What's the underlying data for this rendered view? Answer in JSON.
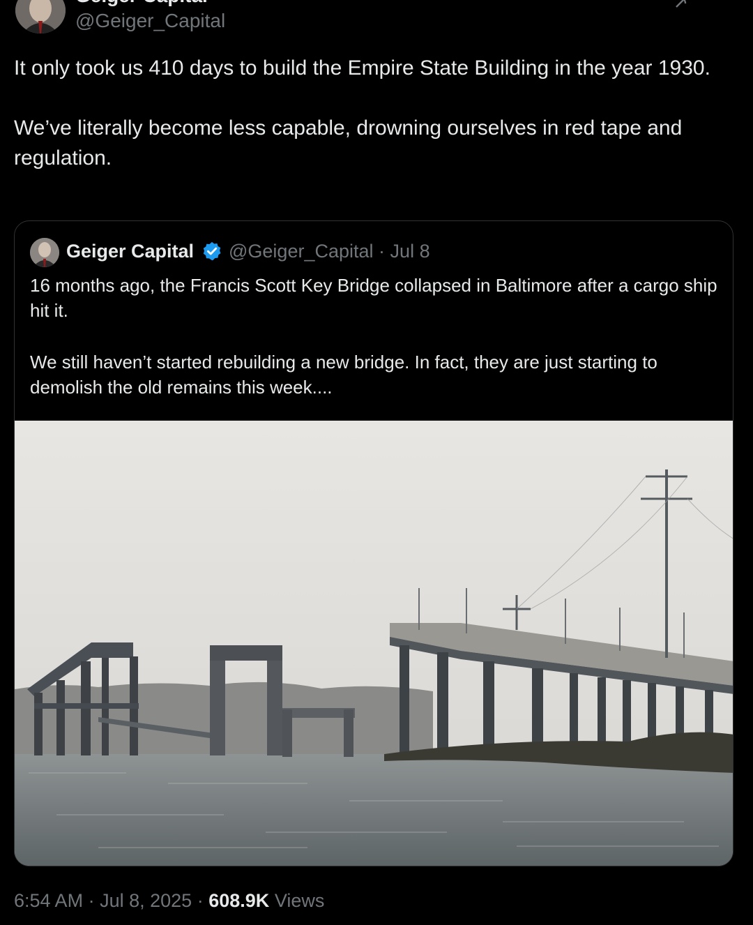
{
  "author": {
    "display_name": "Geiger Capital",
    "handle": "@Geiger_Capital",
    "verified_badge_icon": "verified-badge-icon",
    "avatar_icon": "avatar"
  },
  "tweet": {
    "paragraphs": [
      "It only took us 410 days to build the Empire State Building in the year 1930.",
      "We’ve literally become less capable, drowning ourselves in red tape and regulation."
    ]
  },
  "quoted_tweet": {
    "display_name": "Geiger Capital",
    "handle": "@Geiger_Capital",
    "separator": "·",
    "date": "Jul 8",
    "paragraphs": [
      "16 months ago, the Francis Scott Key Bridge collapsed in Baltimore after a cargo ship hit it.",
      "We still haven’t started rebuilding a new bridge. In fact, they are just starting to demolish the old remains this week...."
    ],
    "media": "photo of collapsed bridge remains over water"
  },
  "footer": {
    "time": "6:54 AM",
    "date": "Jul 8, 2025",
    "views_count": "608.9K",
    "views_label": "Views"
  },
  "colors": {
    "background": "#000000",
    "text": "#e7e9ea",
    "secondary": "#71767b",
    "verified": "#1d9bf0",
    "border": "#2f3336"
  }
}
